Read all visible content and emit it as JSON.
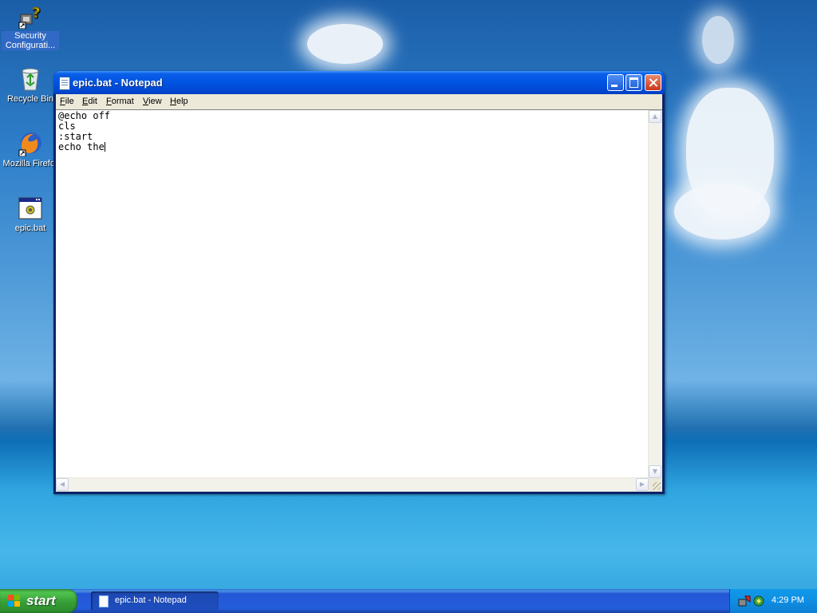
{
  "desktop": {
    "icons": [
      {
        "label": "Security Configurati...",
        "icon": "security-wizard-icon"
      },
      {
        "label": "Recycle Bin",
        "icon": "recycle-bin-icon"
      },
      {
        "label": "Mozilla Firefox",
        "icon": "firefox-icon"
      },
      {
        "label": "epic.bat",
        "icon": "batch-file-icon"
      }
    ]
  },
  "window": {
    "title": "epic.bat - Notepad",
    "menu": {
      "file": {
        "u": "F",
        "rest": "ile"
      },
      "edit": {
        "u": "E",
        "rest": "dit"
      },
      "format": {
        "u": "F",
        "rest": "ormat"
      },
      "view": {
        "u": "V",
        "rest": "iew"
      },
      "help": {
        "u": "H",
        "rest": "elp"
      }
    },
    "content": "@echo off\ncls\n:start\necho the"
  },
  "taskbar": {
    "start_label": "start",
    "task_label": "epic.bat - Notepad",
    "clock": "4:29 PM"
  },
  "colors": {
    "titlebar": "#0054e3",
    "taskbar": "#245edb",
    "start": "#379e37",
    "tray": "#0f8ee3"
  }
}
